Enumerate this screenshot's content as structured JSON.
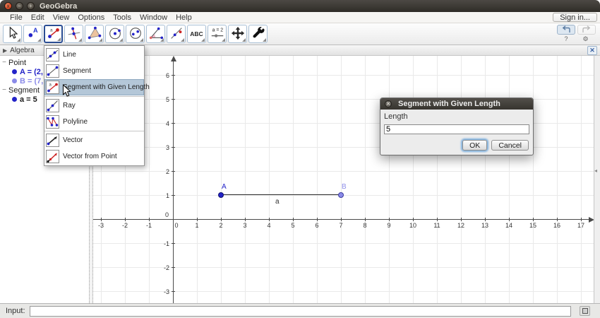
{
  "window": {
    "title": "GeoGebra"
  },
  "menu_bar": {
    "items": [
      "File",
      "Edit",
      "View",
      "Options",
      "Tools",
      "Window",
      "Help"
    ],
    "sign_in_label": "Sign in..."
  },
  "toolbar": {
    "text_tool_label": "ABC",
    "slider_tool_label": "a = 2",
    "help_label": "?",
    "tools": [
      "move",
      "point",
      "segment-with-given-length",
      "perpendicular-line",
      "polygon",
      "circle-with-center",
      "conic",
      "angle",
      "line-with-points",
      "text",
      "slider",
      "move-graphics-view",
      "customize"
    ],
    "active_tool": "segment-with-given-length"
  },
  "tool_menu": {
    "groups": [
      [
        {
          "label": "Line",
          "icon": "line-icon"
        },
        {
          "label": "Segment",
          "icon": "segment-icon"
        },
        {
          "label": "Segment with Given Length",
          "icon": "segment-given-length-icon",
          "highlighted": true
        }
      ],
      [
        {
          "label": "Ray",
          "icon": "ray-icon"
        },
        {
          "label": "Polyline",
          "icon": "polyline-icon"
        }
      ],
      [
        {
          "label": "Vector",
          "icon": "vector-icon"
        },
        {
          "label": "Vector from Point",
          "icon": "vector-from-point-icon"
        }
      ]
    ]
  },
  "algebra_panel": {
    "title": "Algebra",
    "groups": [
      {
        "label": "Point",
        "items": [
          {
            "text": "A = (2,",
            "color": "#2323c8",
            "dot": "#2323c8"
          },
          {
            "text": "B = (7,",
            "color": "#8a8ae8",
            "dot": "#8a8ae8"
          }
        ]
      },
      {
        "label": "Segment",
        "items": [
          {
            "text": "a = 5",
            "color": "#1a1a1a",
            "dot": "#2323c8"
          }
        ]
      }
    ]
  },
  "graphics": {
    "x_ticks": [
      -3,
      -2,
      -1,
      0,
      1,
      2,
      3,
      4,
      5,
      6,
      7,
      8,
      9,
      10,
      11,
      12,
      13,
      14,
      15,
      16,
      17
    ],
    "y_ticks": [
      6,
      5,
      4,
      3,
      2,
      1,
      -1,
      -2,
      -3
    ],
    "origin_label": "0",
    "points": [
      {
        "label": "A",
        "x": 2,
        "y": 1,
        "fill": "#2323c8",
        "stroke": "#12126e",
        "label_color": "#2323c8"
      },
      {
        "label": "B",
        "x": 7,
        "y": 1,
        "fill": "#8a8ae8",
        "stroke": "#3d3da0",
        "label_color": "#8d8de8"
      }
    ],
    "segment": {
      "label": "a",
      "from": [
        2,
        1
      ],
      "to": [
        7,
        1
      ],
      "color": "#2b2b2b"
    }
  },
  "dialog": {
    "title": "Segment with Given Length",
    "field_label": "Length",
    "field_value": "5",
    "ok_label": "OK",
    "cancel_label": "Cancel"
  },
  "input_bar": {
    "label": "Input:",
    "value": ""
  }
}
